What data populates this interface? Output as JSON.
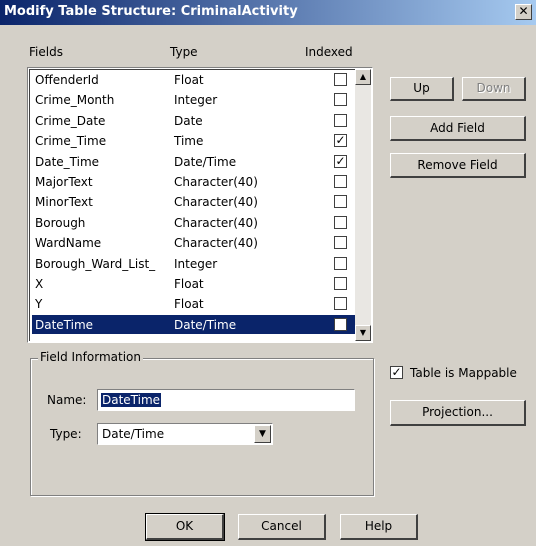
{
  "window": {
    "title": "Modify Table Structure: CriminalActivity",
    "close_glyph": "✕"
  },
  "columns": {
    "fields": "Fields",
    "type": "Type",
    "indexed": "Indexed"
  },
  "fields": [
    {
      "name": "OffenderId",
      "type": "Float",
      "indexed": false,
      "selected": false
    },
    {
      "name": "Crime_Month",
      "type": "Integer",
      "indexed": false,
      "selected": false
    },
    {
      "name": "Crime_Date",
      "type": "Date",
      "indexed": false,
      "selected": false
    },
    {
      "name": "Crime_Time",
      "type": "Time",
      "indexed": true,
      "selected": false
    },
    {
      "name": "Date_Time",
      "type": "Date/Time",
      "indexed": true,
      "selected": false
    },
    {
      "name": "MajorText",
      "type": "Character(40)",
      "indexed": false,
      "selected": false
    },
    {
      "name": "MinorText",
      "type": "Character(40)",
      "indexed": false,
      "selected": false
    },
    {
      "name": "Borough",
      "type": "Character(40)",
      "indexed": false,
      "selected": false
    },
    {
      "name": "WardName",
      "type": "Character(40)",
      "indexed": false,
      "selected": false
    },
    {
      "name": "Borough_Ward_List_",
      "type": "Integer",
      "indexed": false,
      "selected": false
    },
    {
      "name": "X",
      "type": "Float",
      "indexed": false,
      "selected": false
    },
    {
      "name": "Y",
      "type": "Float",
      "indexed": false,
      "selected": false
    },
    {
      "name": "DateTime",
      "type": "Date/Time",
      "indexed": false,
      "selected": true
    }
  ],
  "buttons": {
    "up": "Up",
    "down": "Down",
    "add_field": "Add Field",
    "remove_field": "Remove Field",
    "projection": "Projection...",
    "ok": "OK",
    "cancel": "Cancel",
    "help": "Help"
  },
  "field_info": {
    "group_label": "Field Information",
    "name_label": "Name:",
    "name_value": "DateTime",
    "type_label": "Type:",
    "type_value": "Date/Time"
  },
  "mappable": {
    "label": "Table is Mappable",
    "checked": true
  },
  "icons": {
    "scroll_up": "▲",
    "scroll_down": "▼",
    "dropdown": "▼",
    "check": "✓"
  }
}
